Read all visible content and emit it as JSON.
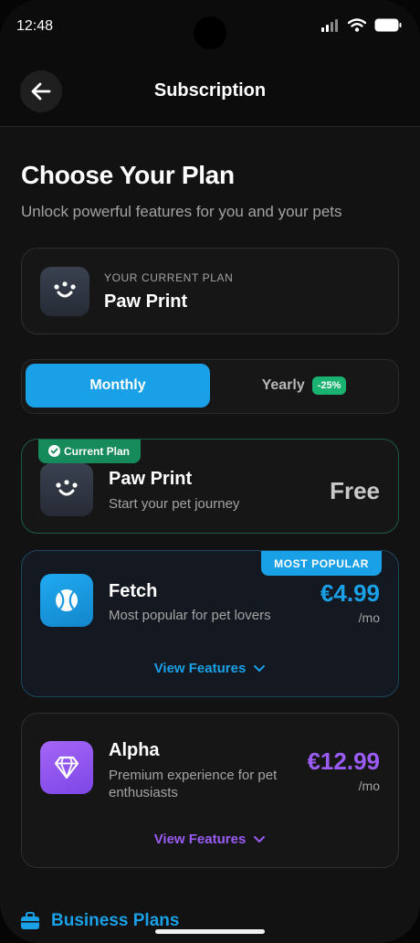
{
  "status_bar": {
    "time": "12:48"
  },
  "header": {
    "title": "Subscription"
  },
  "intro": {
    "title": "Choose Your Plan",
    "subtitle": "Unlock powerful features for you and your pets"
  },
  "current_plan": {
    "label": "YOUR CURRENT PLAN",
    "name": "Paw Print"
  },
  "billing_toggle": {
    "monthly_label": "Monthly",
    "yearly_label": "Yearly",
    "yearly_discount": "-25%",
    "selected": "Monthly"
  },
  "plans": [
    {
      "badge": "Current Plan",
      "name": "Paw Print",
      "description": "Start your pet journey",
      "price": "Free",
      "icon": "paw-face-icon",
      "accent": "#c9c9c9"
    },
    {
      "badge": "MOST POPULAR",
      "name": "Fetch",
      "description": "Most popular for pet lovers",
      "price": "€4.99",
      "period": "/mo",
      "view_features": "View Features",
      "icon": "tennis-ball-icon",
      "accent": "#1aa0e6"
    },
    {
      "name": "Alpha",
      "description": "Premium experience for pet enthusiasts",
      "price": "€12.99",
      "period": "/mo",
      "view_features": "View Features",
      "icon": "diamond-icon",
      "accent": "#9a5cf5"
    }
  ],
  "business": {
    "label": "Business Plans",
    "icon": "briefcase-icon"
  },
  "colors": {
    "accent_blue": "#1aa0e6",
    "accent_green": "#19b271",
    "accent_purple": "#9a5cf5",
    "background": "#121212"
  }
}
